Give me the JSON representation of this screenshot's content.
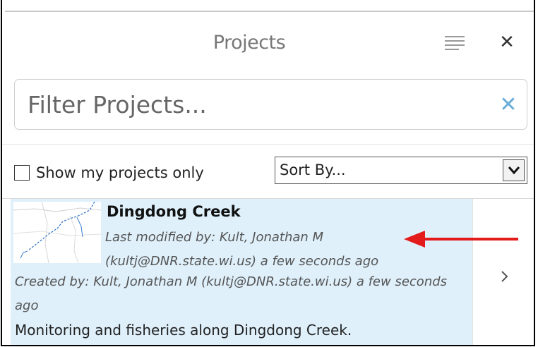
{
  "panel": {
    "title": "Projects",
    "menu_icon": "list-lines-icon",
    "close_icon": "close-icon",
    "close_glyph": "✕"
  },
  "filter": {
    "placeholder": "Filter Projects...",
    "value": "",
    "clear_icon": "clear-x-icon",
    "clear_glyph": "✕"
  },
  "options": {
    "show_mine_label": "Show my projects only",
    "show_mine_checked": false,
    "sort_label": "Sort By...",
    "sort_arrow_icon": "chevron-down-icon"
  },
  "projects": [
    {
      "name": "Dingdong Creek",
      "thumbnail_icon": "map-thumbnail-icon",
      "modified": "Last modified by: Kult, Jonathan M (kultj@DNR.state.wi.us) a few seconds ago",
      "created": "Created by: Kult, Jonathan M (kultj@DNR.state.wi.us) a few seconds ago",
      "description": "Monitoring and fisheries along Dingdong Creek.",
      "open_icon": "chevron-right-icon"
    }
  ],
  "colors": {
    "selected_row": "#dff0fb",
    "clear_x": "#6aaed8",
    "annotation_arrow": "#e31b1b"
  },
  "annotation": {
    "icon": "red-arrow-icon"
  }
}
